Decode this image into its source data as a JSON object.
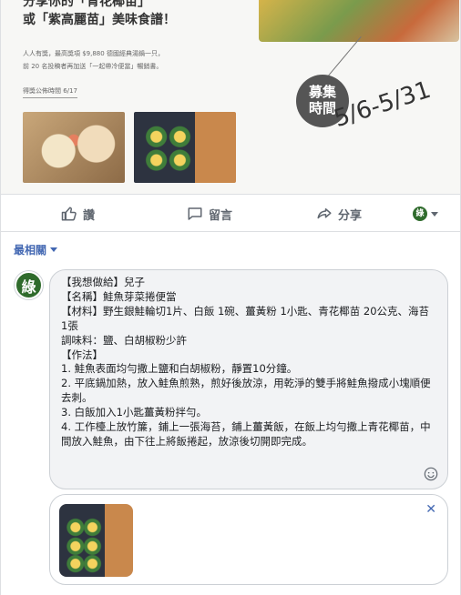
{
  "banner": {
    "headline_1": "分享你的「青花椰苗」",
    "headline_2": "或「紫高麗苗」美味食譜！",
    "small_1": "人人有獎，最高獎項 $9,880 德國經典湯鍋一只，",
    "small_2": "前 20 名投稿者再加送「一起帶冷便當」暢銷書。",
    "announce": "得獎公佈時間 6/17",
    "badge_line1": "募集",
    "badge_line2": "時間",
    "dates": "5/6-5/31"
  },
  "actions": {
    "like": "讚",
    "comment": "留言",
    "share": "分享"
  },
  "page_avatar_text": "綠",
  "sort_label": "最相關",
  "composer": {
    "avatar_text": "綠",
    "text": "【我想做給】兒子\n【名稱】鮭魚芽菜捲便當\n【材料】野生銀鮭輪切1片、白飯 1碗、薑黃粉 1小匙、青花椰苗 20公克、海苔 1張\n調味料：鹽、白胡椒粉少許\n【作法】\n1. 鮭魚表面均勻撒上鹽和白胡椒粉，靜置10分鐘。\n2. 平底鍋加熱，放入鮭魚煎熟，煎好後放涼，用乾淨的雙手將鮭魚撥成小塊順便去刺。\n3. 白飯加入1小匙薑黃粉拌勻。\n4. 工作檯上放竹簾，鋪上一張海苔，鋪上薑黃飯，在飯上均勻撒上青花椰苗，中間放入鮭魚，由下往上將飯捲起，放涼後切開即完成。"
  },
  "attachment": {
    "close": "✕"
  },
  "colors": {
    "link_blue": "#4267b2",
    "brand_green": "#2f6b2c",
    "action_gray": "#606770"
  }
}
